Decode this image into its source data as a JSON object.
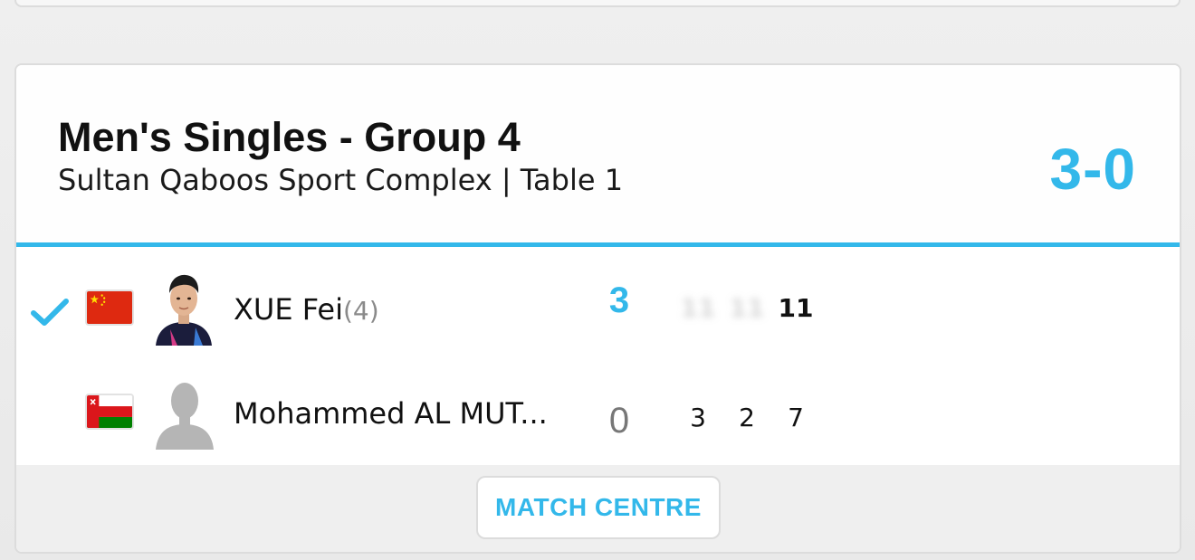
{
  "match": {
    "title": "Men's Singles - Group 4",
    "venue": "Sultan Qaboos Sport Complex | Table 1",
    "score": "3-0"
  },
  "players": [
    {
      "name": "XUE Fei",
      "seed": "(4)",
      "flag": "china-flag",
      "avatar": "player-photo",
      "winner": true,
      "sets_won": "3",
      "games": [
        "11",
        "11",
        "11"
      ],
      "games_visible": [
        false,
        false,
        true
      ]
    },
    {
      "name": "Mohammed AL MUT...",
      "seed": "",
      "flag": "oman-flag",
      "avatar": "placeholder-avatar",
      "winner": false,
      "sets_won": "0",
      "games": [
        "3",
        "2",
        "7"
      ],
      "games_visible": [
        true,
        true,
        true
      ]
    }
  ],
  "footer": {
    "match_centre_label": "MATCH CENTRE"
  },
  "colors": {
    "accent": "#33b8ea",
    "card_bg": "#ffffff",
    "page_bg": "#ececec",
    "footer_bg": "#efefef"
  }
}
